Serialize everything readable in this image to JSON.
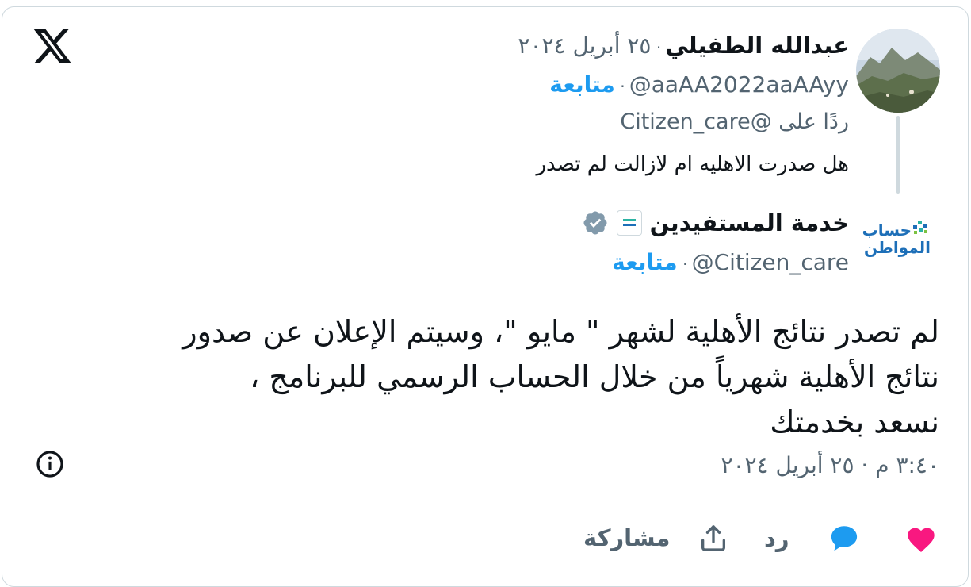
{
  "reply": {
    "author_name": "عبدالله الطفيلي",
    "date": "٢٥ أبريل ٢٠٢٤",
    "handle": "@aaAA2022aaAAyy",
    "follow_label": "متابعة",
    "replying_to": "ردًا على @Citizen_care",
    "text": "هل صدرت الاهليه ام لازالت لم تصدر"
  },
  "main": {
    "author_name": "خدمة المستفيدين",
    "handle": "@Citizen_care",
    "follow_label": "متابعة",
    "logo_text_top": "حساب",
    "logo_text_bottom": "المواطن",
    "text_lines": [
      "لم تصدر نتائج الأهلية لشهر \" مايو \"، وسيتم الإعلان عن صدور",
      "نتائج الأهلية شهرياً من خلال الحساب الرسمي للبرنامج ،",
      "نسعد بخدمتك"
    ],
    "timestamp": "٣:٤٠ م · ٢٥ أبريل ٢٠٢٤"
  },
  "actions": {
    "reply_label": "رد",
    "share_label": "مشاركة"
  },
  "icons": {
    "logo": "x-logo-icon",
    "verified": "verified-badge-icon",
    "info": "info-icon",
    "like": "heart-icon",
    "reply": "reply-bubble-icon",
    "share": "share-icon"
  },
  "colors": {
    "accent": "#1d9bf0",
    "like": "#f91880",
    "muted": "#536471",
    "verified_badge": "#829aab"
  }
}
